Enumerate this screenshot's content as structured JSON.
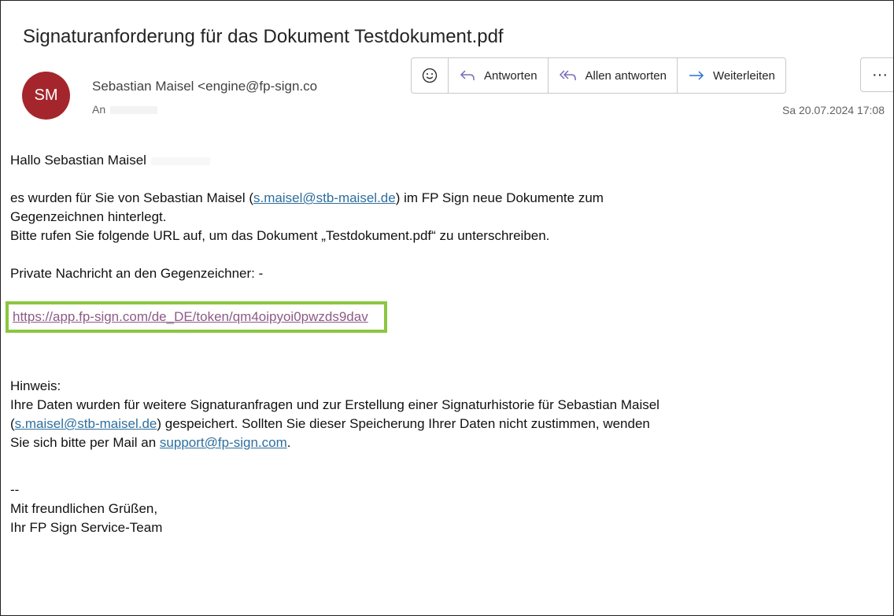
{
  "email": {
    "subject": "Signaturanforderung für das Dokument Testdokument.pdf",
    "avatar_initials": "SM",
    "avatar_color": "#a4262c",
    "sender": "Sebastian Maisel <engine@fp-sign.co",
    "to_label": "An",
    "date": "Sa 20.07.2024 17:08"
  },
  "toolbar": {
    "emoji_icon": "smiley-icon",
    "reply_label": "Antworten",
    "reply_all_label": "Allen antworten",
    "forward_label": "Weiterleiten",
    "more_label": "···"
  },
  "body": {
    "greeting": "Hallo Sebastian Maisel",
    "para1_a": "es wurden für Sie von Sebastian Maisel (",
    "para1_link": "s.maisel@stb-maisel.de",
    "para1_b": ") im FP Sign neue Dokumente zum",
    "para1_c": "Gegenzeichnen hinterlegt.",
    "para2": "Bitte rufen Sie folgende URL auf, um das Dokument „Testdokument.pdf“ zu unterschreiben.",
    "private_msg": "Private Nachricht an den Gegenzeichner: -",
    "url": "https://app.fp-sign.com/de_DE/token/qm4oipyoi0pwzds9dav",
    "hint_title": "Hinweis:",
    "hint_a": "Ihre Daten wurden für weitere Signaturanfragen und zur Erstellung einer Signaturhistorie für Sebastian Maisel",
    "hint_paren_open": "(",
    "hint_link": "s.maisel@stb-maisel.de",
    "hint_b": ") gespeichert. Sollten Sie dieser Speicherung Ihrer Daten nicht zustimmen, wenden",
    "hint_c": "Sie sich bitte per Mail an ",
    "support_link": "support@fp-sign.com",
    "hint_period": ".",
    "sig_dashes": "--",
    "sig_line1": "Mit freundlichen Grüßen,",
    "sig_line2": "Ihr FP Sign Service-Team"
  },
  "colors": {
    "highlight_border": "#8cc63f",
    "link": "#2e6f9e",
    "visited_link": "#8e5a86"
  }
}
